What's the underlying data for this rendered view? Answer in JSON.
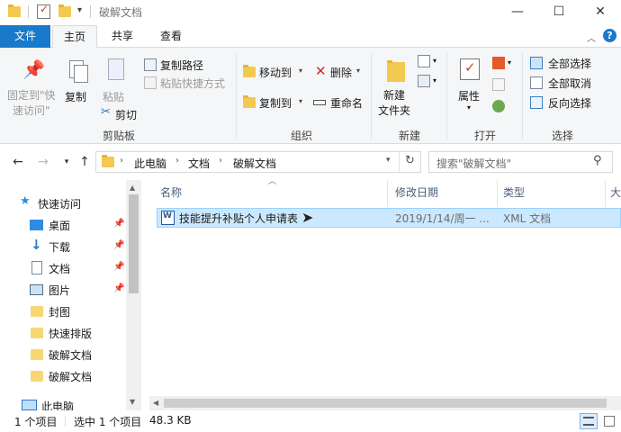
{
  "window": {
    "title": "破解文档",
    "minimize": "—",
    "maximize": "☐",
    "close": "✕"
  },
  "tabs": {
    "file": "文件",
    "home": "主页",
    "share": "共享",
    "view": "查看"
  },
  "ribbon": {
    "clipboard": {
      "pin_quick_access": [
        "固定到\"快",
        "速访问\""
      ],
      "copy": "复制",
      "paste": "粘贴",
      "copy_path": "复制路径",
      "paste_shortcut": "粘贴快捷方式",
      "cut": "剪切",
      "group": "剪贴板"
    },
    "organize": {
      "move_to": "移动到",
      "copy_to": "复制到",
      "delete": "删除",
      "rename": "重命名",
      "group": "组织"
    },
    "new": {
      "new_folder": [
        "新建",
        "文件夹"
      ],
      "group": "新建"
    },
    "open": {
      "properties": "属性",
      "group": "打开"
    },
    "select": {
      "select_all": "全部选择",
      "select_none": "全部取消",
      "invert": "反向选择",
      "group": "选择"
    }
  },
  "address": {
    "segments": [
      "此电脑",
      "文档",
      "破解文档"
    ],
    "search_placeholder": "搜索\"破解文档\""
  },
  "nav": {
    "quick_access": "快速访问",
    "items": [
      {
        "label": "桌面",
        "pinned": true
      },
      {
        "label": "下载",
        "pinned": true
      },
      {
        "label": "文档",
        "pinned": true
      },
      {
        "label": "图片",
        "pinned": true
      },
      {
        "label": "封图",
        "pinned": false
      },
      {
        "label": "快速排版",
        "pinned": false
      },
      {
        "label": "破解文档",
        "pinned": false
      },
      {
        "label": "破解文档",
        "pinned": false
      }
    ],
    "this_pc": "此电脑"
  },
  "columns": {
    "name": "名称",
    "date": "修改日期",
    "type": "类型",
    "size": "大"
  },
  "files": [
    {
      "name": "技能提升补贴个人申请表",
      "date": "2019/1/14/周一 ...",
      "type": "XML 文档",
      "icon": "word-xml-icon"
    }
  ],
  "status": {
    "count": "1 个项目",
    "selected": "选中 1 个项目",
    "size": "48.3 KB"
  },
  "colors": {
    "accent": "#1979ca",
    "selection": "#cce8ff",
    "folder": "#f3c94f"
  }
}
